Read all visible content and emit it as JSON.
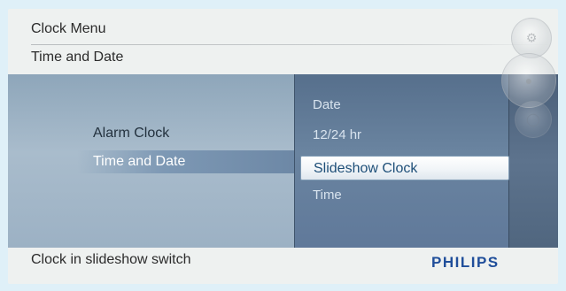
{
  "header": {
    "title": "Clock Menu",
    "subtitle": "Time and Date"
  },
  "left_menu": {
    "items": [
      {
        "label": "Alarm Clock",
        "active": false
      },
      {
        "label": "Time and Date",
        "active": true
      }
    ]
  },
  "right_menu": {
    "items": [
      {
        "label": "Date",
        "selected": false
      },
      {
        "label": "12/24 hr",
        "selected": false
      },
      {
        "label": "Slideshow Clock",
        "selected": true
      },
      {
        "label": "Time",
        "selected": false
      }
    ]
  },
  "footer": {
    "description": "Clock in slideshow switch",
    "brand": "PHILIPS"
  },
  "colors": {
    "background": "#dff0f8",
    "left_panel": "#a9bccc",
    "right_panel": "#6a84a0",
    "brand": "#1f4e9a"
  },
  "icons": [
    "settings-knob-icon",
    "menu-knob-icon",
    "nav-knob-icon"
  ]
}
